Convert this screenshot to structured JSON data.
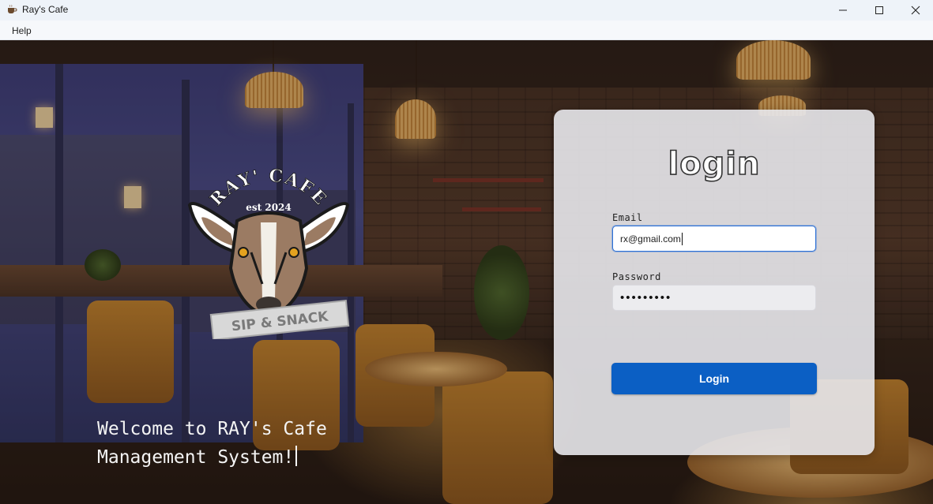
{
  "window": {
    "title": "Ray's Cafe",
    "app_icon": "coffee-cup-icon",
    "controls": [
      "minimize-icon",
      "maximize-icon",
      "close-icon"
    ]
  },
  "menu": {
    "items": [
      {
        "label": "Help"
      }
    ]
  },
  "logo": {
    "top_text": "RAY' CAFE",
    "est_text": "est 2024",
    "banner_text": "SIP & SNACK"
  },
  "welcome": {
    "line1": "Welcome to RAY's Cafe",
    "line2": "Management System!"
  },
  "login_card": {
    "title": "login",
    "email_label": "Email",
    "email_value": "rx@gmail.com",
    "password_label": "Password",
    "password_value": "•••••••••",
    "button_label": "Login"
  },
  "colors": {
    "accent": "#0b5fc4",
    "focus_border": "#2f72d6",
    "titlebar": "#eef3f9"
  }
}
